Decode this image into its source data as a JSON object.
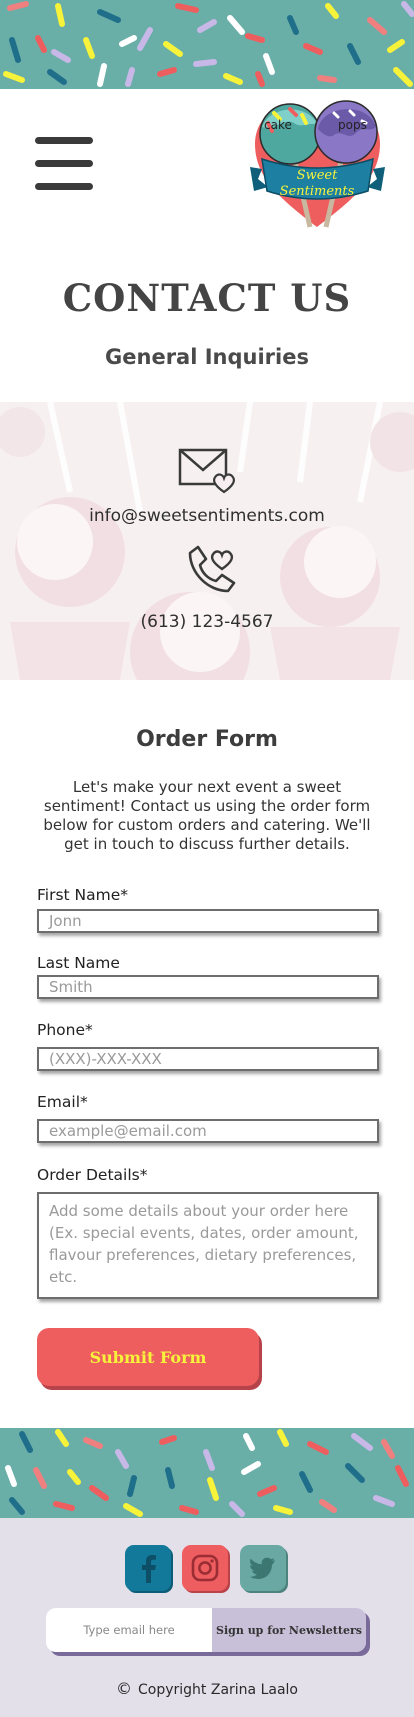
{
  "header": {
    "logo_text_line1": "Sweet",
    "logo_text_line2": "Sentiments",
    "logo_left": "cake",
    "logo_right": "pops"
  },
  "page": {
    "title": "CONTACT US",
    "subtitle": "General Inquiries"
  },
  "contact": {
    "email": "info@sweetsentiments.com",
    "phone": "(613) 123-4567"
  },
  "form": {
    "title": "Order Form",
    "intro": "Let's make your next event a sweet sentiment! Contact us using the order form below for custom orders and catering. We'll get in touch to discuss further details.",
    "fields": {
      "first_name": {
        "label": "First Name*",
        "placeholder": "Jonn"
      },
      "last_name": {
        "label": "Last Name",
        "placeholder": "Smith"
      },
      "phone": {
        "label": "Phone*",
        "placeholder": "(XXX)-XXX-XXX"
      },
      "email": {
        "label": "Email*",
        "placeholder": "example@email.com"
      },
      "details": {
        "label": "Order Details*",
        "placeholder": "Add some details about your order here (Ex. special events, dates, order amount, flavour preferences, dietary preferences, etc."
      }
    },
    "submit_label": "Submit Form"
  },
  "footer": {
    "social": [
      "facebook-icon",
      "instagram-icon",
      "twitter-icon"
    ],
    "newsletter_placeholder": "Type email here",
    "newsletter_button": "Sign up for Newsletters",
    "copyright_symbol": "©",
    "copyright": "Copyright Zarina Laalo"
  },
  "colors": {
    "teal": "#6aaea8",
    "coral": "#ef5e5e",
    "yellow": "#f6f33a",
    "lavender": "#e4e0ea",
    "facebook": "#13799b"
  }
}
